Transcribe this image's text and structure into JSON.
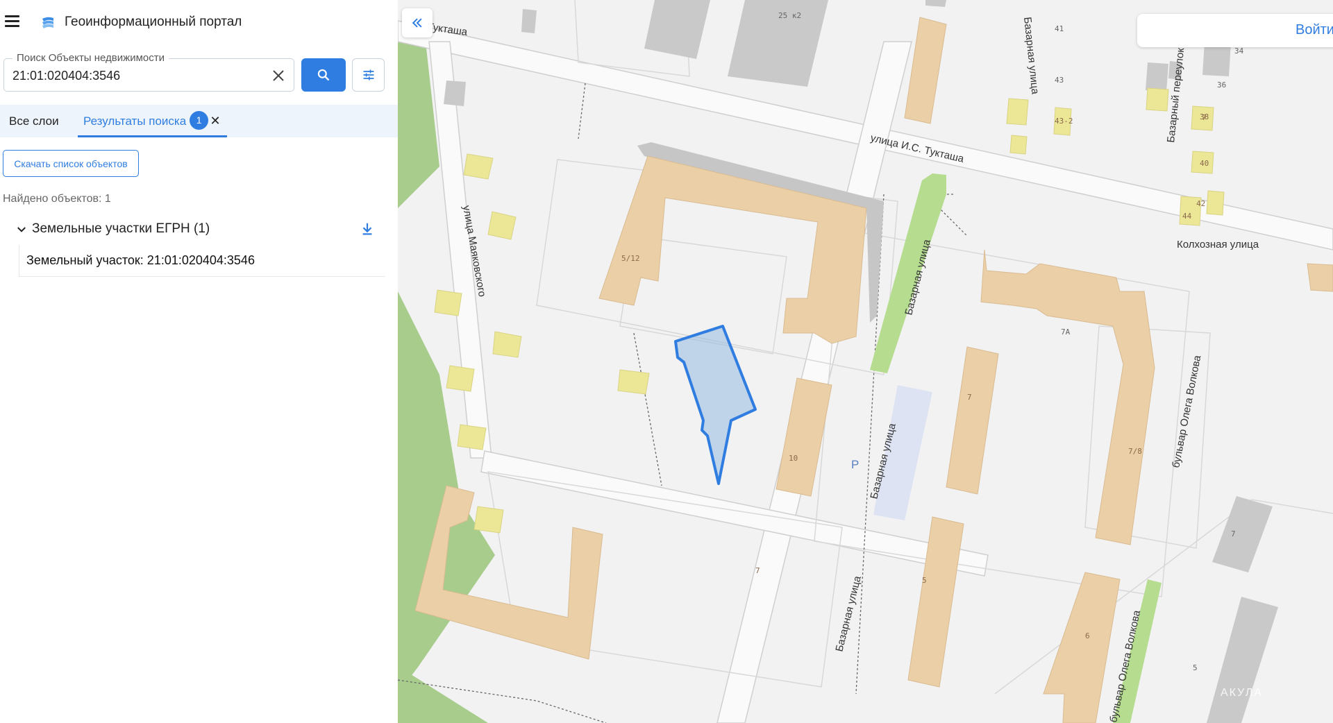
{
  "app": {
    "title": "Геоинформационный портал"
  },
  "search": {
    "label": "Поиск Объекты недвижимости",
    "value": "21:01:020404:3546"
  },
  "tabs": {
    "all_label": "Все слои",
    "results_label": "Результаты поиска",
    "results_count": "1",
    "close_glyph": "✕"
  },
  "results": {
    "download_list_label": "Скачать список объектов",
    "found_text": "Найдено объектов: 1",
    "group_title": "Земельные участки ЕГРН (1)",
    "item_label": "Земельный участок: 21:01:020404:3546"
  },
  "map": {
    "login_label": "Войти",
    "watermark": "АКУЛА",
    "parking_label": "P",
    "streets": {
      "tuktasha_short": "Тукташа",
      "tuktasha": "улица И.С. Тукташа",
      "bazarnaya": "Базарная улица",
      "bazarny_pereulok": "Базарный переулок",
      "kolkhoznaya": "Колхозная улица",
      "mayakovskogo": "улица Маяковского",
      "volkova": "бульвар Олега Волкова"
    },
    "buildings": [
      "25 к2",
      "41",
      "43",
      "43-2",
      "34",
      "36",
      "38",
      "40",
      "42",
      "44",
      "7",
      "5/12",
      "10",
      "7",
      "7/8",
      "7А",
      "7",
      "5",
      "6",
      "5",
      "7"
    ]
  },
  "colors": {
    "accent": "#2f7de1",
    "building": "#ebcfa6",
    "green": "#a8cc8c",
    "parcel_fill": "#b8cfe8",
    "parcel_stroke": "#2f7de1"
  },
  "icons": [
    "menu-icon",
    "portal-logo-icon",
    "clear-icon",
    "search-icon",
    "filter-icon",
    "chevron-down-icon",
    "download-icon",
    "double-chevron-left-icon"
  ]
}
